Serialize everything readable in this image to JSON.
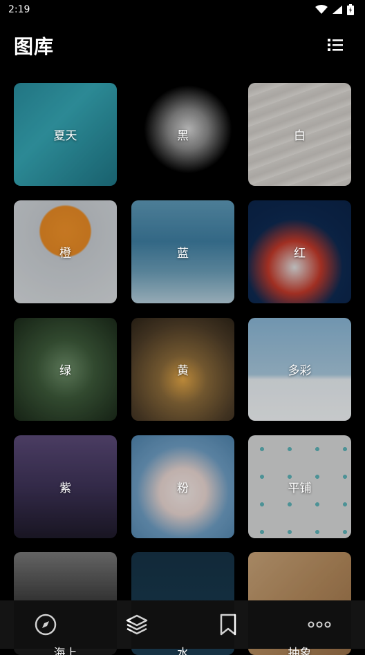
{
  "status": {
    "time": "2:19"
  },
  "header": {
    "title": "图库",
    "list_icon": "list-view-icon"
  },
  "tiles": [
    {
      "label": "夏天",
      "bg": "linear-gradient(135deg,#2a8fa0 0%,#36a8b6 40%,#1f7686 100%)"
    },
    {
      "label": "黑",
      "bg": "radial-gradient(circle at 55% 45%,#d8d8d8 0%,#8a8a8a 25%,#000 55%)"
    },
    {
      "label": "白",
      "bg": "repeating-linear-gradient(160deg,#d9d6d1 0px,#cfcbc6 10px,#e4e1dc 20px)"
    },
    {
      "label": "橙",
      "bg": "radial-gradient(circle at 50% 30%,#f0922a 0%,#e98b25 28%,#c9ced3 30%,#d9dde0 100%)"
    },
    {
      "label": "蓝",
      "bg": "linear-gradient(180deg,#5e9ab8 0%,#3f7fa3 40%,#6da0ba 70%,#b7d0dd 100%)"
    },
    {
      "label": "红",
      "bg": "radial-gradient(circle at 45% 65%,#e2e2e2 0%,#c43a2a 30%,#0e2a52 55%,#0a2348 100%)"
    },
    {
      "label": "绿",
      "bg": "radial-gradient(circle at 50% 50%,#6e8f6a 0%,#3d5a3a 40%,#1b2a1a 100%)"
    },
    {
      "label": "黄",
      "bg": "radial-gradient(circle at 50% 60%,#e3a646 0%,#8a6a3a 30%,#4e3d28 70%,#2d2418 100%)"
    },
    {
      "label": "多彩",
      "bg": "linear-gradient(180deg,#8ab7d6 0%,#a9c9de 55%,#e8eef2 60%,#f2f5f7 100%)"
    },
    {
      "label": "紫",
      "bg": "linear-gradient(180deg,#5b4a78 0%,#3e3358 50%,#1e1a2a 100%)"
    },
    {
      "label": "粉",
      "bg": "radial-gradient(circle at 50% 55%,#f4ebe8 0%,#ead7d2 30%,#6e9ec4 60%,#4f84ad 100%)"
    },
    {
      "label": "平铺",
      "bg": "radial-gradient(circle,#5fb3b8 10%,transparent 11%) 0 0/40px 40px, #d8d9d9"
    },
    {
      "label": "海上",
      "bg": "linear-gradient(180deg,#7a7a7a 0%,#3b3b3b 50%,#1a1a1a 100%)"
    },
    {
      "label": "水",
      "bg": "linear-gradient(180deg,#163346 0%,#1b3d54 100%)"
    },
    {
      "label": "抽象",
      "bg": "linear-gradient(135deg,#caa57a 0%,#b48a5c 50%,#9a7048 100%)"
    }
  ],
  "bottomnav": [
    {
      "name": "explore-icon"
    },
    {
      "name": "layers-icon"
    },
    {
      "name": "bookmark-icon"
    },
    {
      "name": "more-icon"
    }
  ]
}
